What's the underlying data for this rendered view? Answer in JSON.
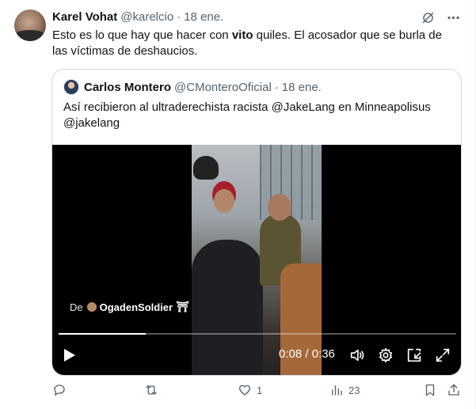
{
  "tweet": {
    "author_name": "Karel Vohat",
    "author_handle": "@karelcio",
    "separator": "·",
    "date": "18 ene.",
    "text_before": "Esto es lo que hay que hacer con ",
    "text_bold": "vito",
    "text_after": " quiles. El acosador que se burla de las víctimas de deshaucios."
  },
  "quote": {
    "author_name": "Carlos Montero",
    "author_handle": "@CMonteroOficial",
    "separator": "·",
    "date": "18 ene.",
    "text": "Así recibieron al ultraderechista racista @JakeLang en Minneapolisus @jakelang"
  },
  "video": {
    "source_prefix": "De",
    "source_name": "OgadenSoldier",
    "source_suffix": "⛩",
    "time_display": "0:08 / 0:36",
    "progress": 0.22
  },
  "actions": {
    "reply_count": "",
    "retweet_count": "",
    "like_count": "1",
    "views_count": "23"
  },
  "icons": {
    "top": [
      "grok-icon",
      "more-icon"
    ],
    "video": [
      "play-icon",
      "volume-icon",
      "settings-icon",
      "popout-icon",
      "fullscreen-icon"
    ],
    "actions": [
      "reply-icon",
      "retweet-icon",
      "like-icon",
      "views-icon",
      "bookmark-icon",
      "share-icon"
    ]
  },
  "colors": {
    "text_primary": "#0f1419",
    "text_secondary": "#536471",
    "border": "#cfd9de",
    "video_bg": "#000000"
  }
}
